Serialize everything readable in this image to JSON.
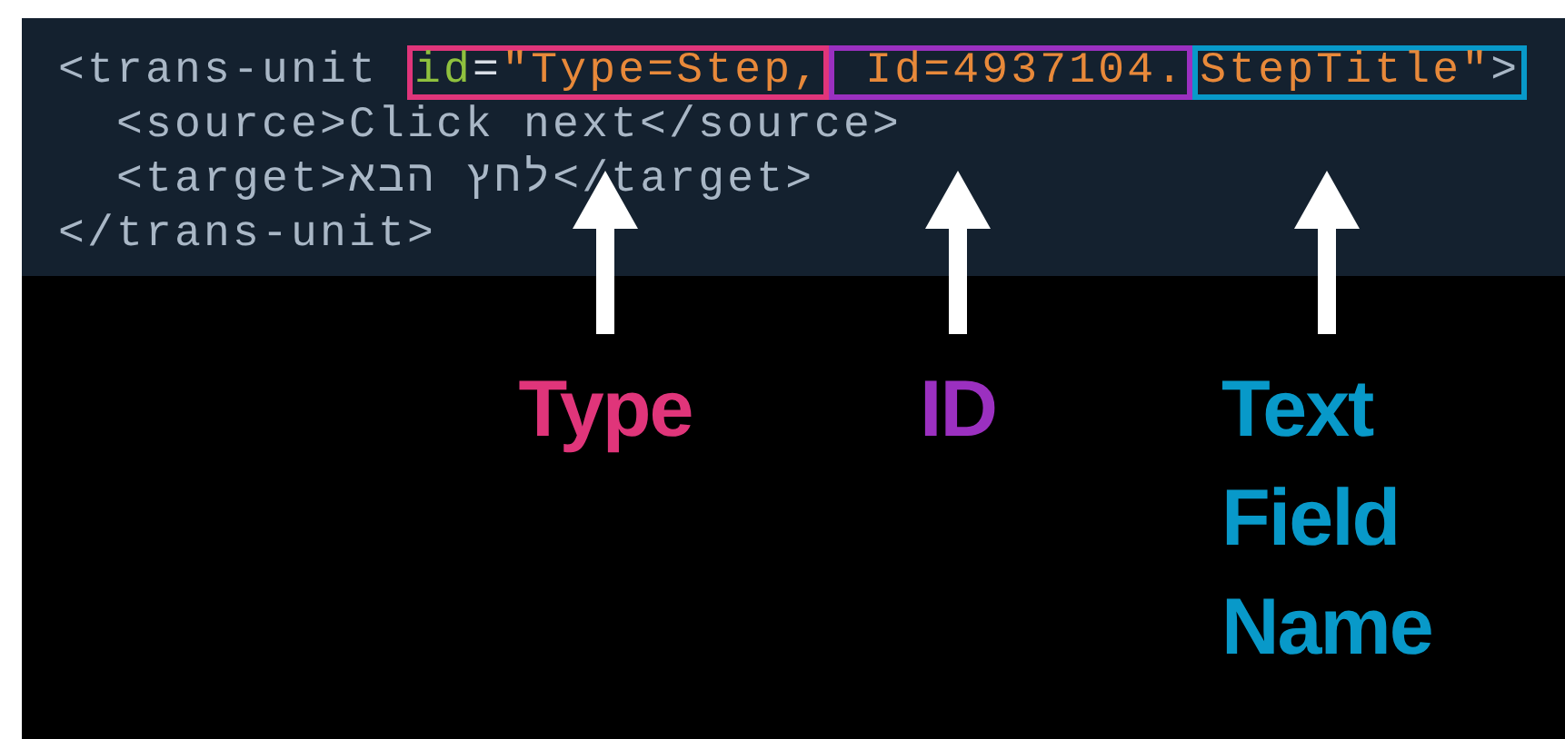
{
  "code": {
    "open": [
      {
        "kind": "tag",
        "text": "<trans-unit "
      },
      {
        "kind": "group",
        "color": "#e0357a",
        "tokens": [
          {
            "kind": "attr",
            "text": "id"
          },
          {
            "kind": "punct",
            "text": "="
          },
          {
            "kind": "value",
            "text": "\"Type=Step,"
          }
        ]
      },
      {
        "kind": "group",
        "color": "#9b30c0",
        "tokens": [
          {
            "kind": "value",
            "text": " Id=4937104."
          }
        ]
      },
      {
        "kind": "group",
        "color": "#0899c9",
        "tokens": [
          {
            "kind": "value",
            "text": "StepTitle\""
          },
          {
            "kind": "tag",
            "text": ">"
          }
        ]
      }
    ],
    "children": [
      {
        "text": "<source>Click next</source>"
      },
      {
        "text": "<target>לחץ הבא</target>"
      }
    ],
    "close": "</trans-unit>"
  },
  "annotations": [
    {
      "label": "Type",
      "color": "#e0357a"
    },
    {
      "label": "ID",
      "color": "#9b30c0"
    },
    {
      "label": "Text Field Name",
      "color": "#0899c9"
    }
  ]
}
